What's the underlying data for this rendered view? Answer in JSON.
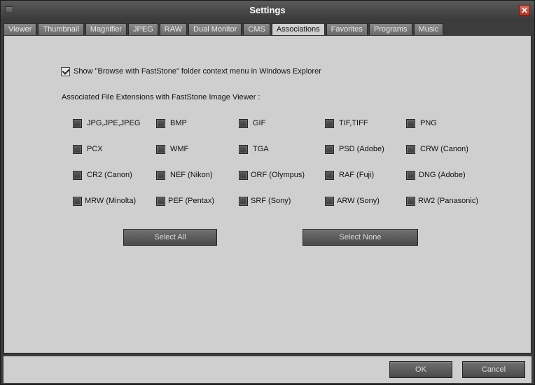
{
  "window": {
    "title": "Settings",
    "close_glyph": "✕"
  },
  "tabs": [
    {
      "label": "Viewer"
    },
    {
      "label": "Thumbnail"
    },
    {
      "label": "Magnifier"
    },
    {
      "label": "JPEG"
    },
    {
      "label": "RAW"
    },
    {
      "label": "Dual Monitor"
    },
    {
      "label": "CMS"
    },
    {
      "label": "Associations",
      "active": true
    },
    {
      "label": "Favorites"
    },
    {
      "label": "Programs"
    },
    {
      "label": "Music"
    }
  ],
  "associations": {
    "context_menu_label": "Show \"Browse with FastStone\" folder context menu in Windows Explorer",
    "context_menu_checked": true,
    "extensions_heading": "Associated File Extensions with FastStone Image Viewer :",
    "extensions": [
      [
        "JPG,JPE,JPEG",
        "BMP",
        "GIF",
        "TIF,TIFF",
        "PNG"
      ],
      [
        "PCX",
        "WMF",
        "TGA",
        "PSD (Adobe)",
        "CRW (Canon)"
      ],
      [
        "CR2 (Canon)",
        "NEF (Nikon)",
        "ORF (Olympus)",
        "RAF (Fuji)",
        "DNG (Adobe)"
      ],
      [
        "MRW (Minolta)",
        "PEF (Pentax)",
        "SRF (Sony)",
        "ARW (Sony)",
        "RW2 (Panasonic)"
      ]
    ],
    "select_all_label": "Select All",
    "select_none_label": "Select None"
  },
  "footer": {
    "ok_label": "OK",
    "cancel_label": "Cancel"
  }
}
